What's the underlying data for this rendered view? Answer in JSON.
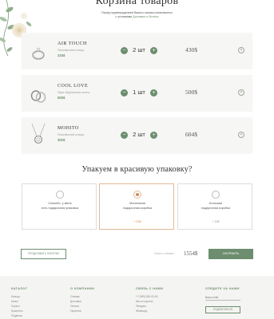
{
  "page": {
    "title": "Корзина товаров",
    "notice_line1": "Перед подтверждением Вашего заказа ознакомьтесь",
    "notice_prefix": "с условиями",
    "notice_link": "Доставки и Оплаты"
  },
  "cart": {
    "items": [
      {
        "name": "AIR TOUCH",
        "subtitle": "Помолвочное кольцо",
        "price": "215$",
        "qty": "2 шт",
        "total": "430$",
        "minus": "−",
        "plus": "+",
        "remove": "×"
      },
      {
        "name": "COOL LOVE",
        "subtitle": "Пара обручальных колец",
        "price": "500$",
        "qty": "1 шт",
        "total": "500$",
        "minus": "−",
        "plus": "+",
        "remove": "×"
      },
      {
        "name": "MOHITO",
        "subtitle": "Помолвочное кольцо",
        "price": "302$",
        "qty": "2 шт",
        "total": "604$",
        "minus": "−",
        "plus": "+",
        "remove": "×"
      }
    ]
  },
  "packaging": {
    "title": "Упакуем в красивую упаковку?",
    "options": [
      {
        "line1": "Спасибо, у меня",
        "line2": "есть подарочная упаковка",
        "extra": "",
        "selected": false
      },
      {
        "line1": "Маленькая",
        "line2": "подарочная коробка",
        "extra": "+ 20$",
        "selected": true
      },
      {
        "line1": "Большая",
        "line2": "подарочная коробка",
        "extra": "+ 30$",
        "selected": false
      }
    ]
  },
  "summary": {
    "back_label": "ПРОДОЛЖИТЬ ПОКУПКИ",
    "total_label": "Итого к оплате:",
    "total_value": "1554$",
    "checkout_label": "ОФОРМИТЬ"
  },
  "footer": {
    "col1": {
      "heading": "КАТАЛОГ",
      "items": [
        "Кольца",
        "Колье",
        "Серьги",
        "Браслеты",
        "Подвески"
      ]
    },
    "col2": {
      "heading": "О КОМПАНИИ",
      "items": [
        "Отзывы",
        "Доставка",
        "Оплата",
        "Гарантии"
      ]
    },
    "col3": {
      "heading": "СВЯЗЬ С НАМИ",
      "items": [
        "+7 (999) 000-00-00",
        "Мы в соцсетях",
        "Telegram",
        "Whatsapp"
      ]
    },
    "col4": {
      "heading": "СЛЕДИТЕ ЗА НАМИ",
      "email_placeholder": "Ваш e-mail",
      "subscribe_label": "ПОДПИСАТЬСЯ"
    }
  },
  "colors": {
    "accent": "#6c8e6f",
    "highlight": "#d28a54",
    "row_bg": "#f6f6f4"
  }
}
